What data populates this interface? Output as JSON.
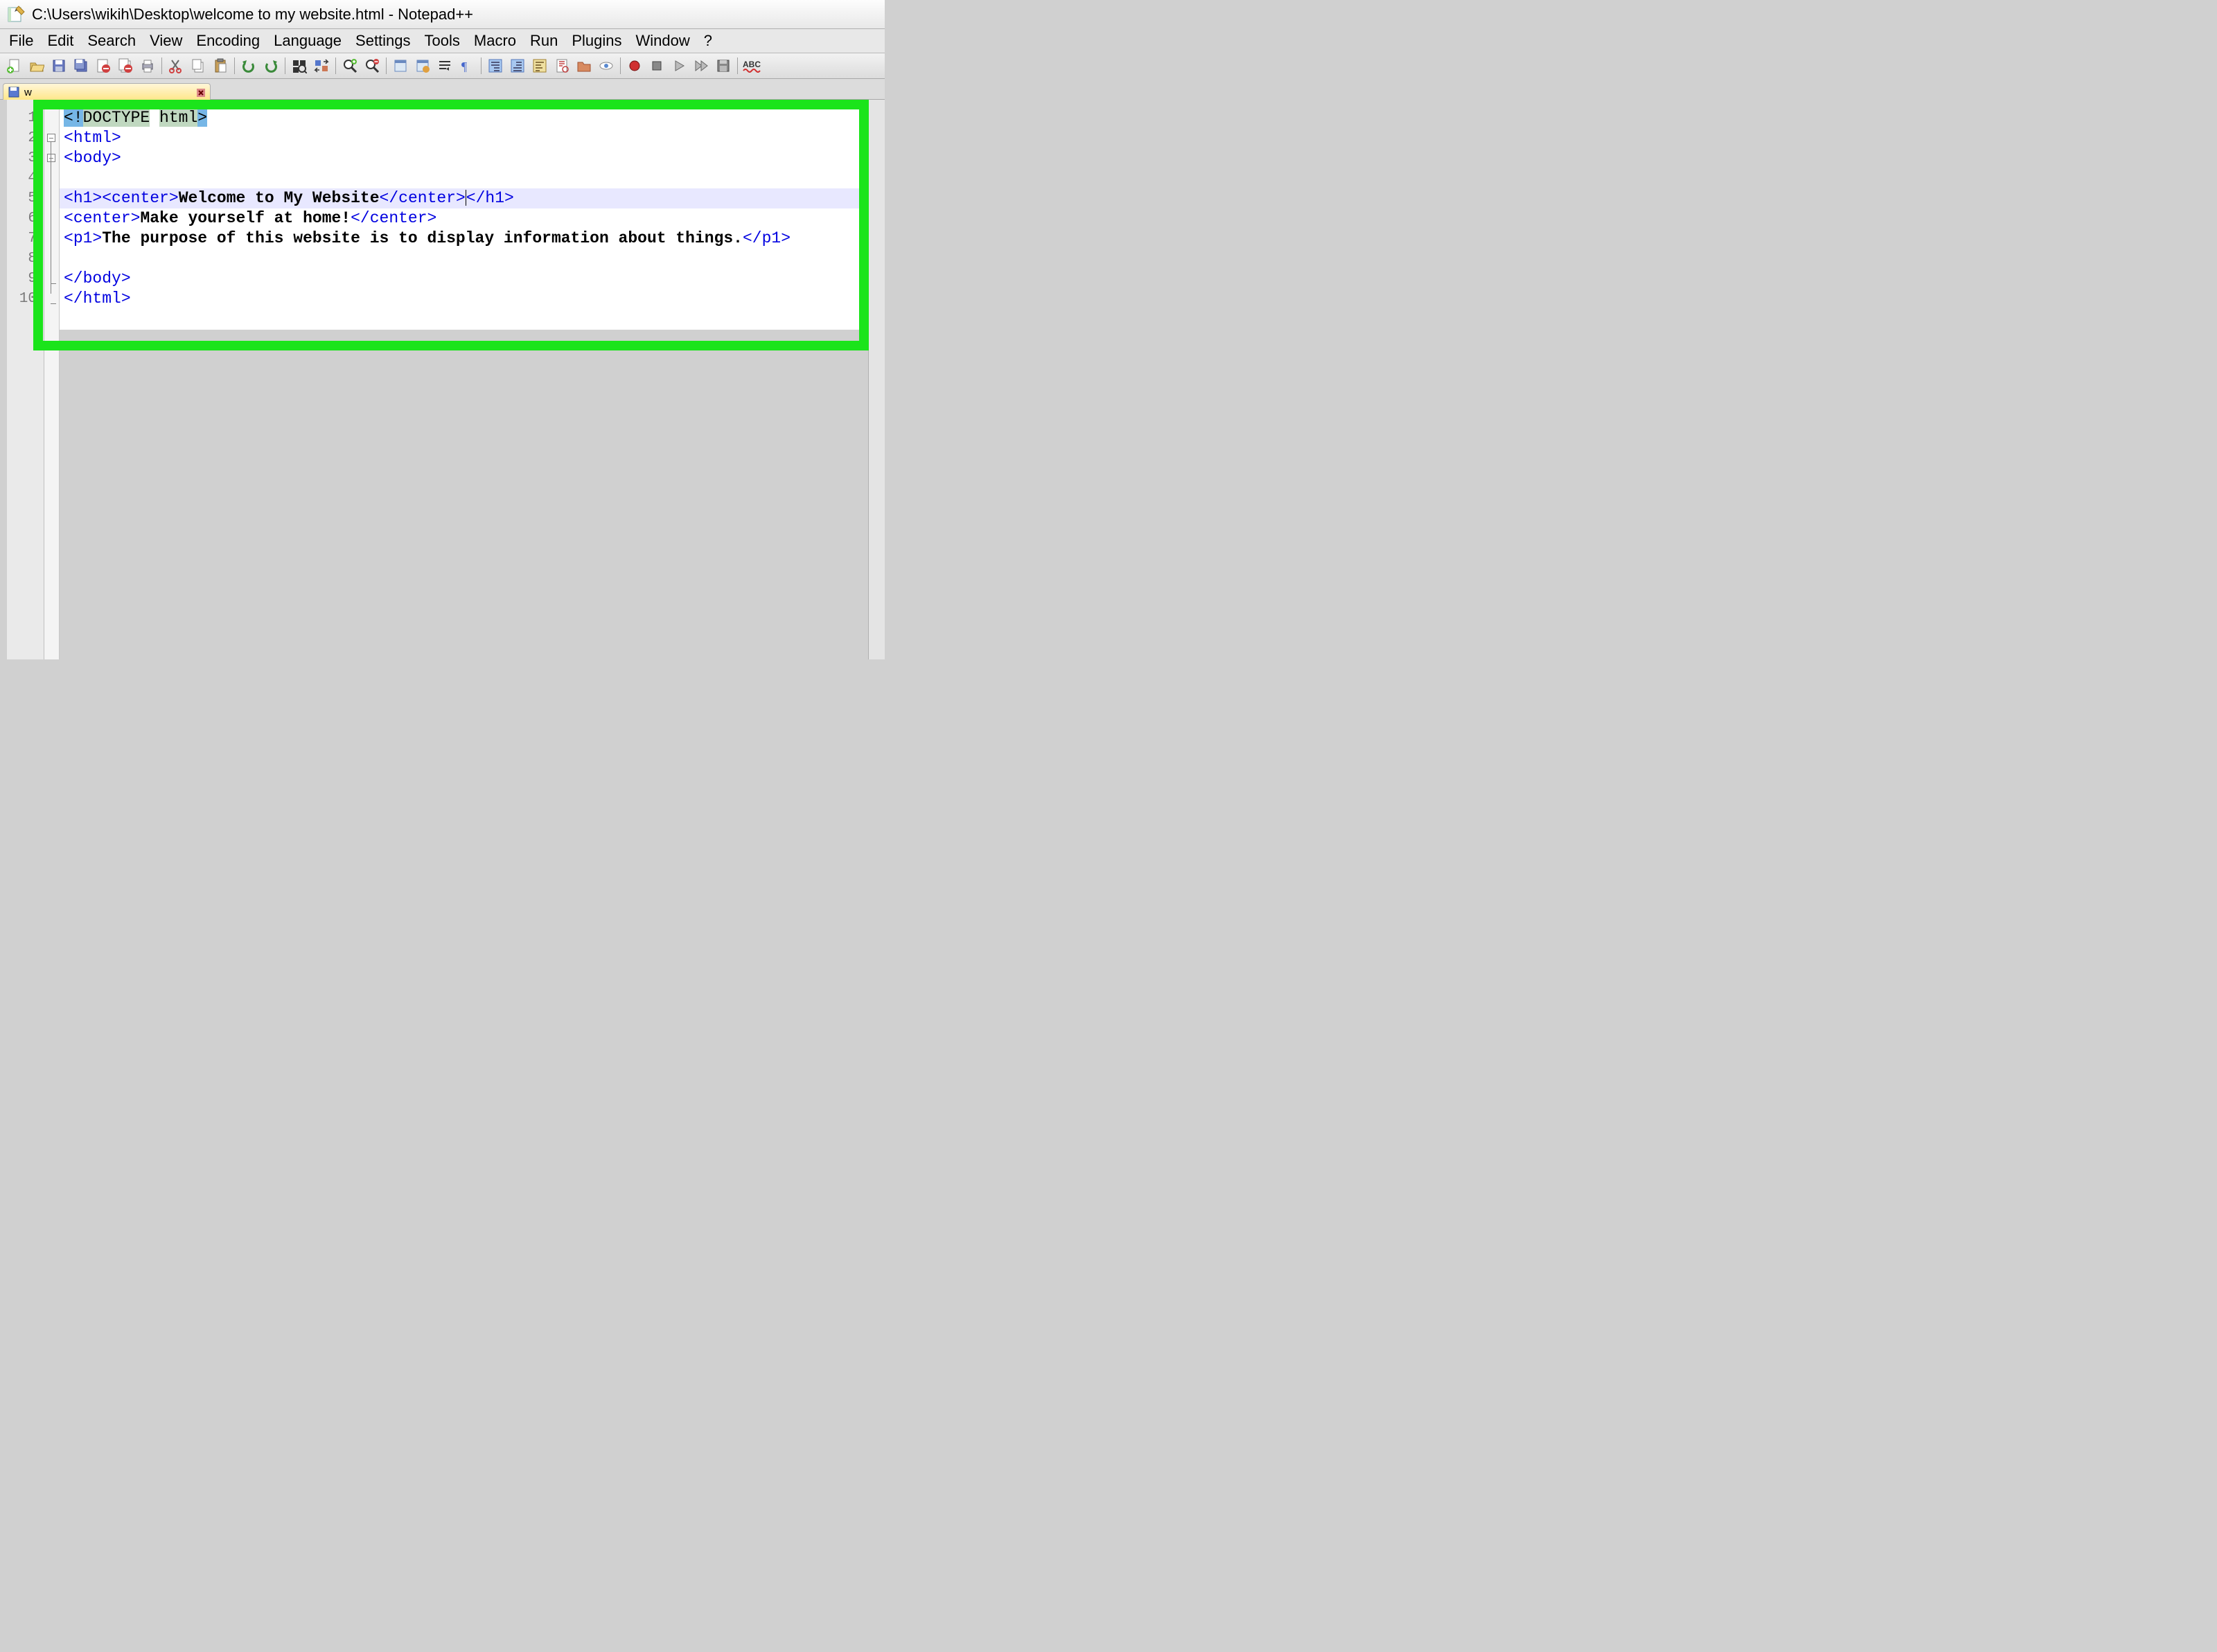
{
  "title": "C:\\Users\\wikih\\Desktop\\welcome to my website.html - Notepad++",
  "menu": {
    "file": "File",
    "edit": "Edit",
    "search": "Search",
    "view": "View",
    "encoding": "Encoding",
    "language": "Language",
    "settings": "Settings",
    "tools": "Tools",
    "macro": "Macro",
    "run": "Run",
    "plugins": "Plugins",
    "window": "Window",
    "help": "?"
  },
  "tab": {
    "label": "w",
    "full_hint": "welcome to my website.html"
  },
  "line_numbers": [
    "1",
    "2",
    "3",
    "4",
    "5",
    "6",
    "7",
    "8",
    "9",
    "10"
  ],
  "code": {
    "l1": {
      "pre": "<!",
      "w1": "DOCTYPE",
      "sp": " ",
      "w2": "html",
      "post": ">"
    },
    "l2": {
      "open": "<",
      "tag": "html",
      "close": ">"
    },
    "l3": {
      "open": "<",
      "tag": "body",
      "close": ">"
    },
    "l5": {
      "h1_open_open": "<",
      "h1_open_tag": "h1",
      "h1_open_close": ">",
      "c_open_open": "<",
      "c_open_tag": "center",
      "c_open_close": ">",
      "text": "Welcome to My Website",
      "c_close_open": "</",
      "c_close_tag": "center",
      "c_close_close": ">",
      "h1_close_open": "</",
      "h1_close_tag": "h1",
      "h1_close_close": ">"
    },
    "l6": {
      "c_open_open": "<",
      "c_open_tag": "center",
      "c_open_close": ">",
      "text": "Make yourself at home!",
      "c_close_open": "</",
      "c_close_tag": "center",
      "c_close_close": ">"
    },
    "l7": {
      "p_open_open": "<",
      "p_open_tag": "p1",
      "p_open_close": ">",
      "text": "The purpose of this website is to display information about things.",
      "p_close_open": "</",
      "p_close_tag": "p1",
      "p_close_close": ">"
    },
    "l9": {
      "open": "</",
      "tag": "body",
      "close": ">"
    },
    "l10": {
      "open": "</",
      "tag": "html",
      "close": ">"
    }
  },
  "toolbar_icons": [
    "new-file",
    "open-file",
    "save",
    "save-all",
    "close",
    "close-all",
    "print",
    "cut",
    "copy",
    "paste",
    "undo",
    "redo",
    "find",
    "replace",
    "zoom-in",
    "zoom-out",
    "sync-v",
    "sync-h",
    "wrap",
    "show-all",
    "indent",
    "outdent",
    "fold-all",
    "unfold-all",
    "folder",
    "eye",
    "record-macro",
    "stop-macro",
    "play-macro",
    "play-multi",
    "save-macro",
    "spellcheck"
  ],
  "colors": {
    "highlight_green": "#1be41b",
    "current_line": "#e8e8ff",
    "selection": "#76b6e6",
    "tag_blue": "#0000e0"
  }
}
